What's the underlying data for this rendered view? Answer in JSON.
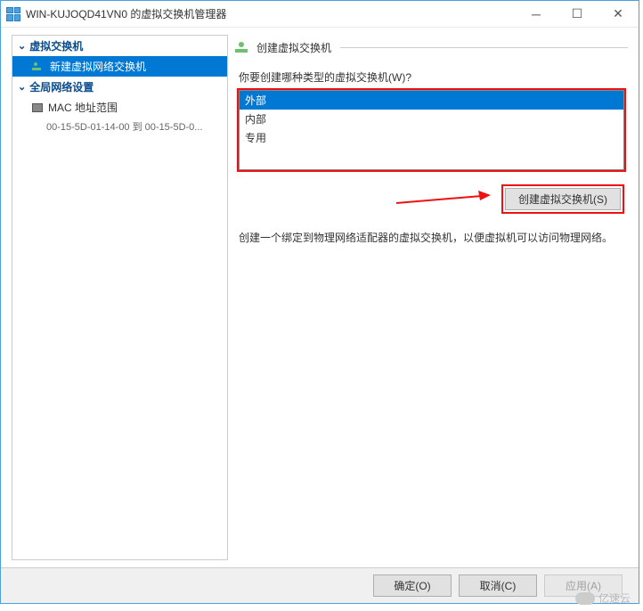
{
  "window": {
    "title": "WIN-KUJOQD41VN0 的虚拟交换机管理器"
  },
  "tree": {
    "section1": "虚拟交换机",
    "item_new": "新建虚拟网络交换机",
    "section2": "全局网络设置",
    "item_mac": "MAC 地址范围",
    "mac_range": "00-15-5D-01-14-00 到 00-15-5D-0..."
  },
  "right": {
    "header": "创建虚拟交换机",
    "prompt": "你要创建哪种类型的虚拟交换机(W)?",
    "options": {
      "external": "外部",
      "internal": "内部",
      "private": "专用"
    },
    "create_btn": "创建虚拟交换机(S)",
    "description": "创建一个绑定到物理网络适配器的虚拟交换机，以便虚拟机可以访问物理网络。"
  },
  "footer": {
    "ok": "确定(O)",
    "cancel": "取消(C)",
    "apply": "应用(A)"
  },
  "watermark": "亿速云"
}
